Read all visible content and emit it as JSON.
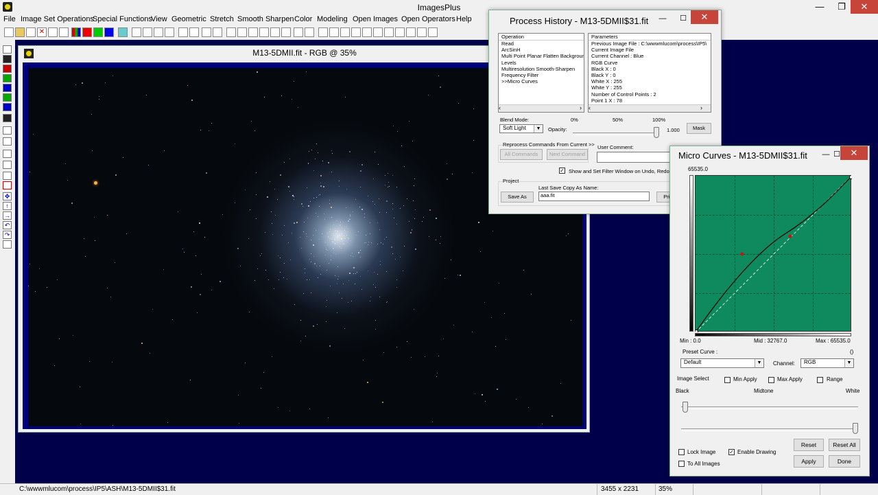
{
  "app": {
    "title": "ImagesPlus"
  },
  "menu": [
    "File",
    "Image Set Operations",
    "Special Functions",
    "View",
    "Geometric",
    "Stretch",
    "Smooth Sharpen",
    "Color",
    "Modeling",
    "Open Images",
    "Open Operators",
    "Help"
  ],
  "image_window": {
    "title": "M13-5DMII.fit - RGB @ 35%"
  },
  "history": {
    "title": "Process History - M13-5DMII$31.fit",
    "operation_header": "Operation",
    "operations": [
      "Read",
      "ArcSinH",
      "Multi Point Planar Flatten Background",
      "Levels",
      "Multiresolution Smooth-Sharpen",
      "Frequency Filter",
      ">>Micro Curves"
    ],
    "parameters_header": "Parameters",
    "parameters": [
      "Previous Image File : C:\\wwwmlucom\\process\\IP5\\",
      "Current Image File",
      "Current Channel : Blue",
      "RGB Curve",
      " Black X : 0",
      " Black Y : 0",
      " White X : 255",
      " White Y : 255",
      " Number of Control Points : 2",
      " Point 1 X : 78"
    ],
    "blend_mode_label": "Blend Mode:",
    "blend_mode_value": "Soft Light",
    "opacity_label": "Opacity:",
    "opacity_pct_0": "0%",
    "opacity_pct_50": "50%",
    "opacity_pct_100": "100%",
    "opacity_value": "1.000",
    "mask_button": "Mask",
    "reprocess_label": "Reprocess Commands From Current >>",
    "all_commands_button": "All Commands",
    "next_command_button": "Next Command",
    "user_comment_label": "User Comment:",
    "show_filter_label": "Show and Set Filter Window on Undo, Redo, D",
    "project_label": "Project",
    "last_save_label": "Last Save Copy As Name:",
    "save_as_button": "Save As",
    "save_name_value": "aaa.fit",
    "print_button": "Print"
  },
  "curves": {
    "title": "Micro Curves - M13-5DMII$31.fit",
    "max_y": "65535.0",
    "min_label": "Min : 0.0",
    "mid_label": "Mid : 32767.0",
    "max_label": "Max : 65535.0",
    "preset_label": "Preset Curve :",
    "preset_paren": "()",
    "preset_value": "Default",
    "channel_label": "Channel:",
    "channel_value": "RGB",
    "image_select_label": "Image Select",
    "min_apply": "Min Apply",
    "max_apply": "Max Apply",
    "range": "Range",
    "black": "Black",
    "midtone": "Midtone",
    "white": "White",
    "lock_image": "Lock Image",
    "enable_drawing": "Enable Drawing",
    "to_all_images": "To All Images",
    "reset_button": "Reset",
    "reset_all_button": "Reset All",
    "apply_button": "Apply",
    "done_button": "Done",
    "line_color": "#000000",
    "point_color": "#cc1111",
    "grid_color": "#0f8a5f"
  },
  "status": {
    "path": "C:\\wwwmlucom\\process\\IP5\\ASH\\M13-5DMII$31.fit",
    "dimensions": "3455 x 2231",
    "zoom": "35%"
  }
}
